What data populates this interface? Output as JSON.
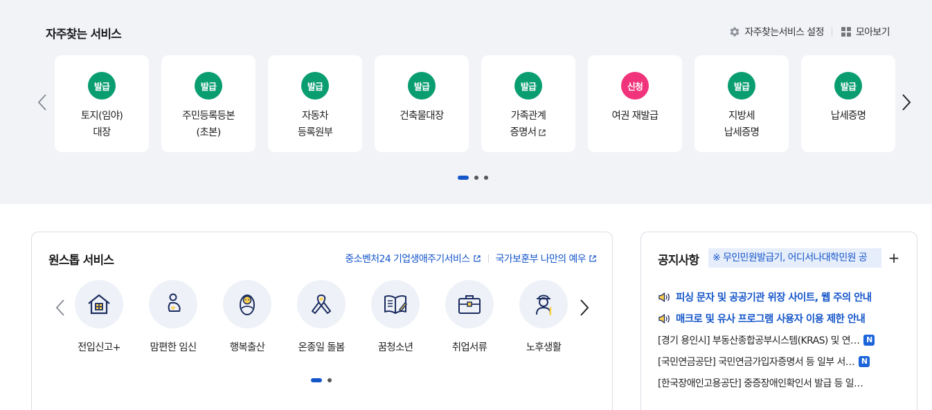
{
  "favorites": {
    "title": "자주찾는 서비스",
    "settings_label": "자주찾는서비스 설정",
    "view_all_label": "모아보기",
    "cards": [
      {
        "badge": "발급",
        "line1": "토지(임야)",
        "line2": "대장",
        "badge_color": "#0a9d6f"
      },
      {
        "badge": "발급",
        "line1": "주민등록등본",
        "line2": "(초본)",
        "badge_color": "#0a9d6f"
      },
      {
        "badge": "발급",
        "line1": "자동차",
        "line2": "등록원부",
        "badge_color": "#0a9d6f"
      },
      {
        "badge": "발급",
        "line1": "건축물대장",
        "line2": "",
        "badge_color": "#0a9d6f"
      },
      {
        "badge": "발급",
        "line1": "가족관계",
        "line2": "증명서",
        "external": true,
        "badge_color": "#0a9d6f"
      },
      {
        "badge": "신청",
        "line1": "여권 재발급",
        "line2": "",
        "badge_color": "#f0337a"
      },
      {
        "badge": "발급",
        "line1": "지방세",
        "line2": "납세증명",
        "badge_color": "#0a9d6f"
      },
      {
        "badge": "발급",
        "line1": "납세증명",
        "line2": "",
        "badge_color": "#0a9d6f"
      }
    ],
    "pager": {
      "pages": 3,
      "current": 1
    }
  },
  "onestop": {
    "title": "원스톱 서비스",
    "links": [
      {
        "label": "중소벤처24 기업생애주기서비스",
        "external": true
      },
      {
        "label": "국가보훈부 나만의 예우",
        "external": true
      }
    ],
    "items": [
      {
        "label": "전입신고+",
        "icon": "house-icon"
      },
      {
        "label": "맘편한 임신",
        "icon": "pregnancy-icon"
      },
      {
        "label": "행복출산",
        "icon": "baby-icon"
      },
      {
        "label": "온종일 돌봄",
        "icon": "ribbon-icon"
      },
      {
        "label": "꿈청소년",
        "icon": "book-icon"
      },
      {
        "label": "취업서류",
        "icon": "briefcase-icon"
      },
      {
        "label": "노후생활",
        "icon": "elderly-icon"
      }
    ],
    "pager": {
      "pages": 2,
      "current": 1
    }
  },
  "notice": {
    "title": "공지사항",
    "ticker": "※ 무인민원발급기, 어디서나대학민원 공",
    "plus": "+",
    "items": [
      {
        "text": "피싱 문자 및 공공기관 위장 사이트, 웹 주의 안내",
        "highlight": true
      },
      {
        "text": "매크로 및 유사 프로그램 사용자 이용 제한 안내",
        "highlight": true
      },
      {
        "text": "[경기 용인시] 부동산종합공부시스템(KRAS) 및 연…",
        "new": "N"
      },
      {
        "text": "[국민연금공단] 국민연금가입자증명서 등 일부 서…",
        "new": "N"
      },
      {
        "text": "[한국장애인고용공단] 중증장애인확인서 발급 등 일…"
      }
    ]
  },
  "colors": {
    "accent": "#1455c9",
    "badge_green": "#0a9d6f",
    "badge_pink": "#f0337a",
    "band_bg": "#f1f3f7"
  }
}
